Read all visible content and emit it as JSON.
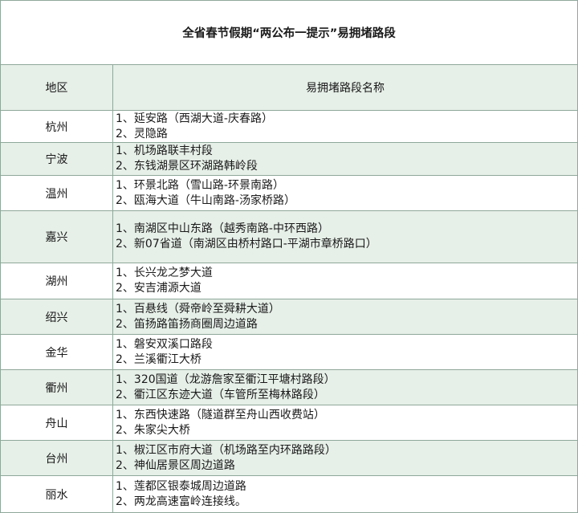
{
  "title": "全省春节假期“两公布一提示”易拥堵路段",
  "headers": {
    "region": "地区",
    "roads": "易拥堵路段名称"
  },
  "rows": [
    {
      "region": "杭州",
      "roads": [
        "1、延安路（西湖大道-庆春路）",
        "2、灵隐路"
      ]
    },
    {
      "region": "宁波",
      "roads": [
        "1、机场路联丰村段",
        "2、东钱湖景区环湖路韩岭段"
      ]
    },
    {
      "region": "温州",
      "roads": [
        "1、环景北路（雪山路-环景南路）",
        "2、瓯海大道（牛山南路-汤家桥路）"
      ]
    },
    {
      "region": "嘉兴",
      "roads": [
        "1、南湖区中山东路（越秀南路-中环西路）",
        "2、新07省道（南湖区由桥村路口-平湖市章桥路口）"
      ]
    },
    {
      "region": "湖州",
      "roads": [
        "1、长兴龙之梦大道",
        "2、安吉浦源大道"
      ]
    },
    {
      "region": "绍兴",
      "roads": [
        "1、百悬线（舜帝岭至舜耕大道）",
        "2、笛扬路笛扬商圈周边道路"
      ]
    },
    {
      "region": "金华",
      "roads": [
        "1、磐安双溪口路段",
        "2、兰溪衢江大桥"
      ]
    },
    {
      "region": "衢州",
      "roads": [
        "1、320国道（龙游詹家至衢江平塘村路段）",
        "2、衢江区东迹大道（车管所至梅林路段）"
      ]
    },
    {
      "region": "舟山",
      "roads": [
        "1、东西快速路（隧道群至舟山西收费站）",
        "2、朱家尖大桥"
      ]
    },
    {
      "region": "台州",
      "roads": [
        "1、椒江区市府大道（机场路至内环路路段）",
        "2、神仙居景区周边道路"
      ]
    },
    {
      "region": "丽水",
      "roads": [
        "1、莲都区银泰城周边道路",
        "2、两龙高速富岭连接线。"
      ]
    }
  ]
}
